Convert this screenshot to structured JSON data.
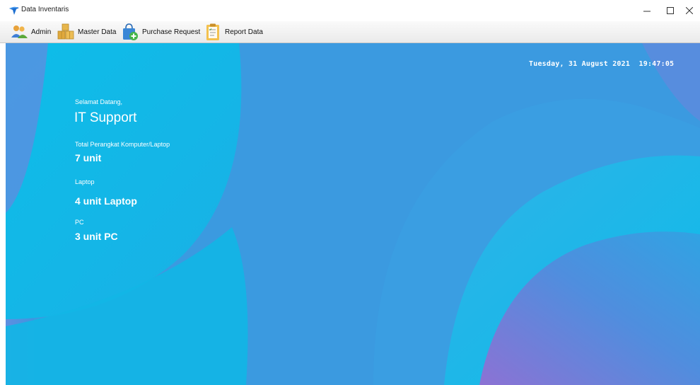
{
  "window": {
    "title": "Data Inventaris",
    "icon": "app-logo-icon",
    "controls": [
      "minimize-icon",
      "maximize-icon",
      "close-icon"
    ]
  },
  "menu": {
    "items": [
      {
        "label": "Admin",
        "icon": "users-icon"
      },
      {
        "label": "Master Data",
        "icon": "boxes-icon"
      },
      {
        "label": "Purchase Request",
        "icon": "shopping-bag-add-icon"
      },
      {
        "label": "Report Data",
        "icon": "clipboard-icon"
      }
    ]
  },
  "dashboard": {
    "datetime": "Tuesday, 31 August 2021  19:47:05",
    "welcome_label": "Selamat Datang,",
    "user_name": "IT Support",
    "total_label": "Total Perangkat Komputer/Laptop",
    "total_value": "7 unit",
    "laptop_label": "Laptop",
    "laptop_value": "4 unit Laptop",
    "pc_label": "PC",
    "pc_value": "3 unit PC"
  },
  "colors": {
    "background_blue": "#3a9ee2",
    "cyan_shape": "#0cbbe8",
    "purple_shape": "#8a73d6",
    "text": "#ffffff"
  }
}
